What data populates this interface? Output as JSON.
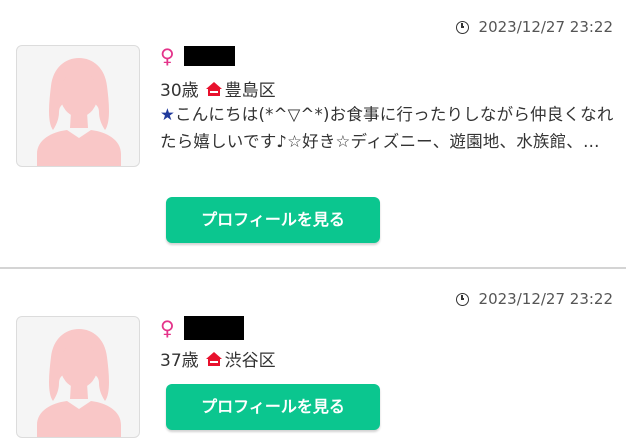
{
  "colors": {
    "accent_button": "#0bc68f",
    "female_symbol": "#e4338a",
    "home_icon": "#e8112d",
    "divider": "#d4d4d4",
    "avatar_silhouette": "#f9c7c7"
  },
  "icons": {
    "timestamp": "clock-icon",
    "gender": "female-symbol-icon",
    "location": "home-icon",
    "avatar": "female-silhouette-placeholder"
  },
  "profiles": [
    {
      "timestamp": "2023/12/27 23:22",
      "gender_symbol": "♀",
      "name": "[redacted]",
      "age": "30歳",
      "location": "豊島区",
      "description_star": "★",
      "description": "こんにちは(*^▽^*)お食事に行ったりしながら仲良くなれたら嬉しいです♪☆好き☆ディズニー、遊園地、水族館、…",
      "button_label": "プロフィールを見る"
    },
    {
      "timestamp": "2023/12/27 23:22",
      "gender_symbol": "♀",
      "name": "[redacted]",
      "age": "37歳",
      "location": "渋谷区",
      "button_label": "プロフィールを見る"
    }
  ]
}
